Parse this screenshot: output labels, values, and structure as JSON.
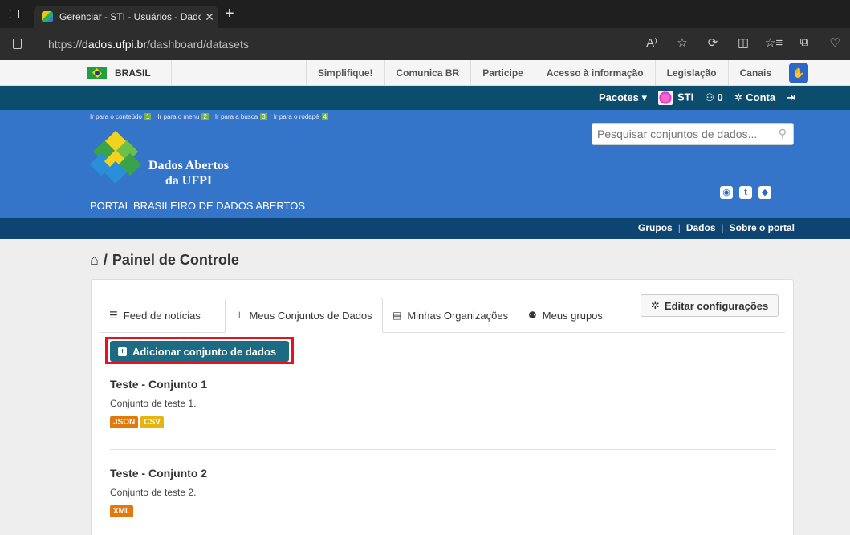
{
  "browser": {
    "tab_title": "Gerenciar - STI - Usuários - Dados",
    "url_prefix": "https://",
    "url_domain": "dados.ufpi.br",
    "url_path": "/dashboard/datasets",
    "tools": [
      "A⁾",
      "☆",
      "⟳",
      "◫",
      "☆≡",
      "⧉",
      "♡"
    ]
  },
  "gov_bar": {
    "brasil": "BRASIL",
    "links": [
      "Simplifique!",
      "Comunica BR",
      "Participe",
      "Acesso à informação",
      "Legislação",
      "Canais"
    ]
  },
  "account_bar": {
    "packages": "Pacotes ▾",
    "user": "STI",
    "notifications": "0",
    "account": "Conta",
    "logout_icon": "sign-out-icon"
  },
  "masthead": {
    "skip_links": [
      {
        "label": "Ir para o conteúdo",
        "key": "1"
      },
      {
        "label": "Ir para o menu",
        "key": "2"
      },
      {
        "label": "Ir para a busca",
        "key": "3"
      },
      {
        "label": "Ir para o rodapé",
        "key": "4"
      }
    ],
    "logo_line1": "Dados Abertos",
    "logo_line2": "da UFPI",
    "portal_name": "PORTAL BRASILEIRO DE DADOS ABERTOS",
    "search_placeholder": "Pesquisar conjuntos de dados...",
    "social": [
      "rss-icon",
      "twitter-icon",
      "github-icon"
    ]
  },
  "nav": {
    "items": [
      "Grupos",
      "Dados",
      "Sobre o portal"
    ]
  },
  "page": {
    "breadcrumb": "Painel de Controle",
    "tabs": [
      {
        "label": "Feed de notícias",
        "icon": "list-icon"
      },
      {
        "label": "Meus Conjuntos de Dados",
        "icon": "sitemap-icon"
      },
      {
        "label": "Minhas Organizações",
        "icon": "building-icon"
      },
      {
        "label": "Meus grupos",
        "icon": "group-icon"
      }
    ],
    "edit_button": "Editar configurações",
    "add_button": "Adicionar conjunto de dados",
    "datasets": [
      {
        "title": "Teste - Conjunto 1",
        "description": "Conjunto de teste 1.",
        "formats": [
          "JSON",
          "CSV"
        ]
      },
      {
        "title": "Teste - Conjunto 2",
        "description": "Conjunto de teste 2.",
        "formats": [
          "XML"
        ]
      }
    ],
    "format_colors": {
      "JSON": "#e07a0c",
      "CSV": "#e5b40f",
      "XML": "#e07a0c"
    }
  },
  "colors": {
    "account_bar": "#0c4d6e",
    "masthead": "#3575c9",
    "navbar": "#0e4472",
    "primary_button": "#1d6b82",
    "highlight": "#e8121f"
  }
}
